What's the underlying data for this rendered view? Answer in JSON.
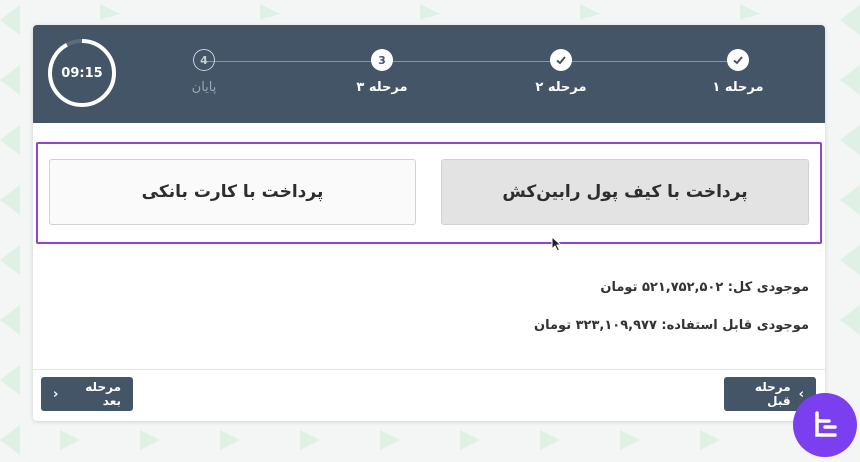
{
  "header": {
    "timer": "09:15",
    "steps": [
      {
        "number": "",
        "label": "مرحله ۱",
        "state": "done"
      },
      {
        "number": "",
        "label": "مرحله ۲",
        "state": "done"
      },
      {
        "number": "3",
        "label": "مرحله ۳",
        "state": "current"
      },
      {
        "number": "4",
        "label": "پایان",
        "state": "pending"
      }
    ]
  },
  "payment": {
    "wallet_label": "پرداخت با کیف پول رابین‌کش",
    "card_label": "پرداخت با کارت بانکی"
  },
  "balances": {
    "total": "موجودی کل: ۵۲۱,۷۵۲,۵۰۲ تومان",
    "available": "موجودی قابل استفاده: ۳۲۳,۱۰۹,۹۷۷ تومان"
  },
  "nav": {
    "prev_label": "مرحله قبل",
    "next_label": "مرحله بعد"
  },
  "colors": {
    "header_bg": "#435566",
    "highlight": "#8e44d6",
    "logo_bg": "#7b3ff0"
  }
}
